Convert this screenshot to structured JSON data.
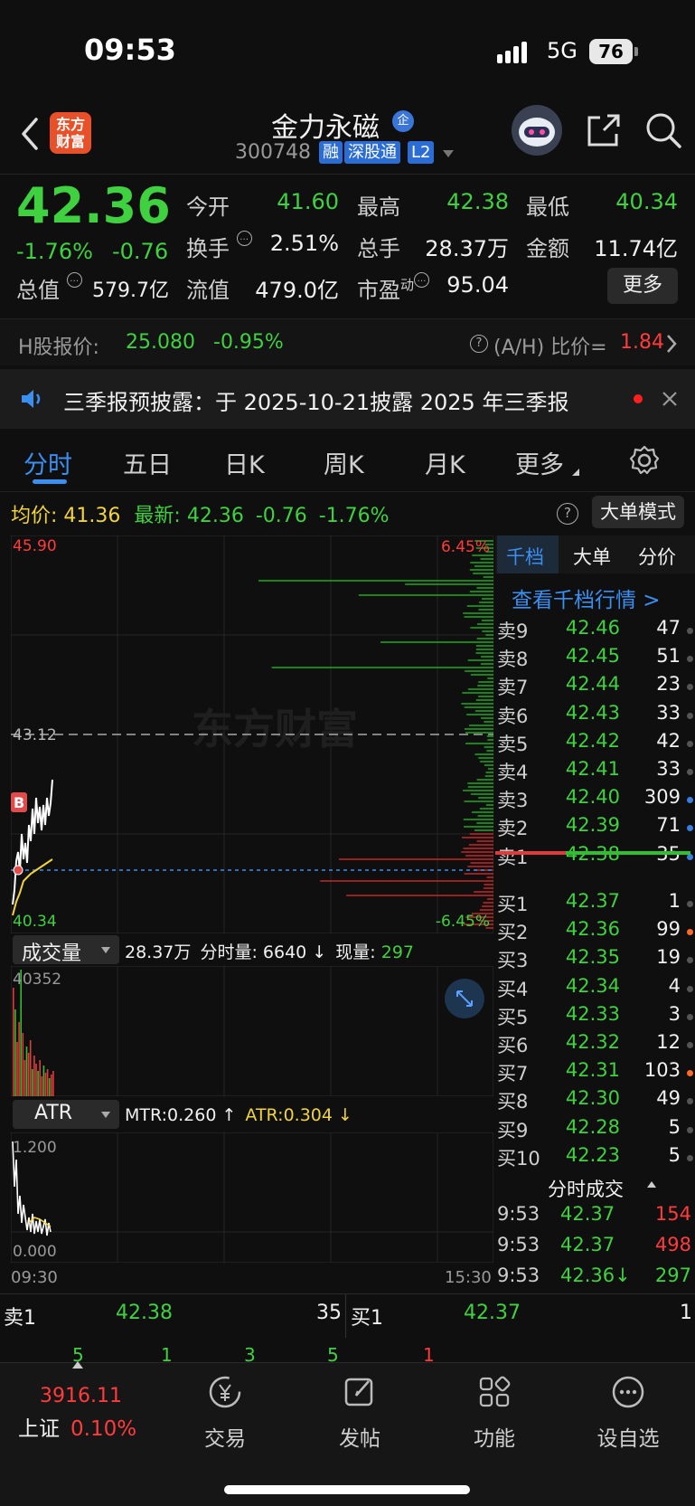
{
  "status": {
    "time": "09:53",
    "network": "5G",
    "battery": "76"
  },
  "header": {
    "logo": "东方财富",
    "name": "金力永磁",
    "corp_badge": "企",
    "code": "300748",
    "tags": [
      "融",
      "深股通",
      "L2"
    ]
  },
  "quote": {
    "price": "42.36",
    "pct": "-1.76%",
    "change": "-0.76",
    "open_label": "今开",
    "open": "41.60",
    "high_label": "最高",
    "high": "42.38",
    "low_label": "最低",
    "low": "40.34",
    "turnover_label": "换手",
    "turnover": "2.51%",
    "volume_label": "总手",
    "volume": "28.37万",
    "amount_label": "金额",
    "amount": "11.74亿",
    "mktcap_label": "总值",
    "mktcap": "579.7亿",
    "float_label": "流值",
    "float": "479.0亿",
    "pe_label": "市盈",
    "pe_sup": "动",
    "pe": "95.04",
    "more": "更多"
  },
  "h_share": {
    "label": "H股报价:",
    "price": "25.080",
    "pct": "-0.95%",
    "ratio_label": "(A/H) 比价=",
    "ratio": "1.84"
  },
  "notice": {
    "text": "三季报预披露：于 2025-10-21披露 2025 年三季报"
  },
  "tabs": [
    "分时",
    "五日",
    "日K",
    "周K",
    "月K",
    "更多"
  ],
  "chart_info": {
    "avg_label": "均价:",
    "avg": "41.36",
    "latest_label": "最新:",
    "latest": "42.36",
    "latest_chg": "-0.76",
    "latest_pct": "-1.76%",
    "big_order_btn": "大单模式"
  },
  "chart": {
    "y_high": "45.90",
    "y_mid": "43.12",
    "y_low": "40.34",
    "pct_high": "6.45%",
    "pct_low": "-6.45%",
    "marker": "B",
    "watermark": "东方财富",
    "avg_price": 41.36
  },
  "volume_panel": {
    "indicator": "成交量",
    "total": "28.37万",
    "tick_label": "分时量:",
    "tick": "6640",
    "tick_arrow": "↓",
    "cur_label": "现量:",
    "cur": "297",
    "max": "40352"
  },
  "atr_panel": {
    "indicator": "ATR",
    "mtr": "MTR:0.260 ↑",
    "atr": "ATR:0.304 ↓",
    "y_top": "1.200",
    "y_bottom": "0.000",
    "x_start": "09:30",
    "x_end": "15:30"
  },
  "orderbook": {
    "tabs": [
      "千档",
      "大单",
      "分价"
    ],
    "link": "查看千档行情 >",
    "asks": [
      {
        "label": "卖9",
        "price": "42.46",
        "vol": "47",
        "dot": "#555555"
      },
      {
        "label": "卖8",
        "price": "42.45",
        "vol": "51",
        "dot": "#555555"
      },
      {
        "label": "卖7",
        "price": "42.44",
        "vol": "23",
        "dot": "#555555"
      },
      {
        "label": "卖6",
        "price": "42.43",
        "vol": "33",
        "dot": "#555555"
      },
      {
        "label": "卖5",
        "price": "42.42",
        "vol": "42",
        "dot": "#555555"
      },
      {
        "label": "卖4",
        "price": "42.41",
        "vol": "33",
        "dot": "#555555"
      },
      {
        "label": "卖3",
        "price": "42.40",
        "vol": "309",
        "dot": "#3a7ee0"
      },
      {
        "label": "卖2",
        "price": "42.39",
        "vol": "71",
        "dot": "#3a7ee0"
      },
      {
        "label": "卖1",
        "price": "42.38",
        "vol": "35",
        "dot": "#3a7ee0"
      }
    ],
    "bids": [
      {
        "label": "买1",
        "price": "42.37",
        "vol": "1",
        "dot": "#555555"
      },
      {
        "label": "买2",
        "price": "42.36",
        "vol": "99",
        "dot": "#ff6a2a"
      },
      {
        "label": "买3",
        "price": "42.35",
        "vol": "19",
        "dot": "#555555"
      },
      {
        "label": "买4",
        "price": "42.34",
        "vol": "4",
        "dot": "#555555"
      },
      {
        "label": "买5",
        "price": "42.33",
        "vol": "3",
        "dot": "#555555"
      },
      {
        "label": "买6",
        "price": "42.32",
        "vol": "12",
        "dot": "#555555"
      },
      {
        "label": "买7",
        "price": "42.31",
        "vol": "103",
        "dot": "#ff6a2a"
      },
      {
        "label": "买8",
        "price": "42.30",
        "vol": "49",
        "dot": "#555555"
      },
      {
        "label": "买9",
        "price": "42.28",
        "vol": "5",
        "dot": "#555555"
      },
      {
        "label": "买10",
        "price": "42.23",
        "vol": "5",
        "dot": "#555555"
      }
    ],
    "ticks_title": "分时成交",
    "ticks": [
      {
        "time": "9:53",
        "price": "42.37",
        "vol": "154"
      },
      {
        "time": "9:53",
        "price": "42.37",
        "vol": "498"
      },
      {
        "time": "9:53",
        "price": "42.36↓",
        "vol": "297"
      }
    ]
  },
  "bottom_quote": {
    "sell_label": "卖1",
    "sell_price": "42.38",
    "sell_vol": "35",
    "buy_label": "买1",
    "buy_price": "42.37",
    "buy_vol": "1",
    "sub": [
      "5",
      "1",
      "3",
      "5",
      "1"
    ]
  },
  "nav": {
    "index_value": "3916.11",
    "index_name": "上证",
    "index_pct": "0.10%",
    "items": [
      "交易",
      "发帖",
      "功能",
      "设自选"
    ]
  },
  "colors": {
    "up": "#ff3b3b",
    "down": "#3fd13f",
    "accent": "#3a7ee0",
    "avg": "#f2d43a"
  }
}
